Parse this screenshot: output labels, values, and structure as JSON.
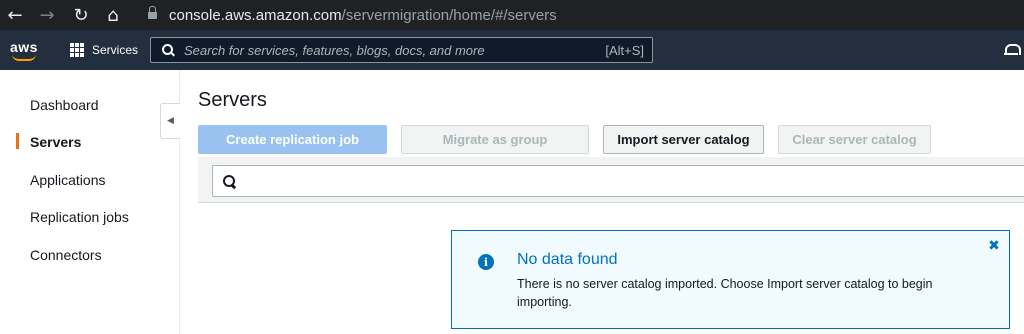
{
  "browser": {
    "url_host": "console.aws.amazon.com",
    "url_path": "/servermigration/home/#/servers"
  },
  "aws_nav": {
    "logo_text": "aws",
    "services_label": "Services",
    "search_placeholder": "Search for services, features, blogs, docs, and more",
    "search_shortcut": "[Alt+S]"
  },
  "sidebar": {
    "items": [
      {
        "label": "Dashboard",
        "active": false
      },
      {
        "label": "Servers",
        "active": true
      },
      {
        "label": "Applications",
        "active": false
      },
      {
        "label": "Replication jobs",
        "active": false
      },
      {
        "label": "Connectors",
        "active": false
      }
    ]
  },
  "main": {
    "title": "Servers",
    "buttons": {
      "create_replication_job": "Create replication job",
      "migrate_as_group": "Migrate as group",
      "import_server_catalog": "Import server catalog",
      "clear_server_catalog": "Clear server catalog"
    },
    "search_value": ""
  },
  "alert": {
    "title": "No data found",
    "body": "There is no server catalog imported. Choose Import server catalog to begin importing."
  },
  "colors": {
    "browser_bar": "#202124",
    "aws_nav": "#232f3e",
    "accent_orange": "#ec7211",
    "info_blue": "#0073bb",
    "alert_bg": "#f1faff",
    "primary_disabled": "#99c2f0"
  },
  "icons": [
    "back-arrow-icon",
    "forward-arrow-icon",
    "reload-icon",
    "home-icon",
    "lock-icon",
    "grid-icon",
    "search-icon",
    "bell-icon",
    "caret-left-icon",
    "info-icon",
    "close-icon"
  ]
}
